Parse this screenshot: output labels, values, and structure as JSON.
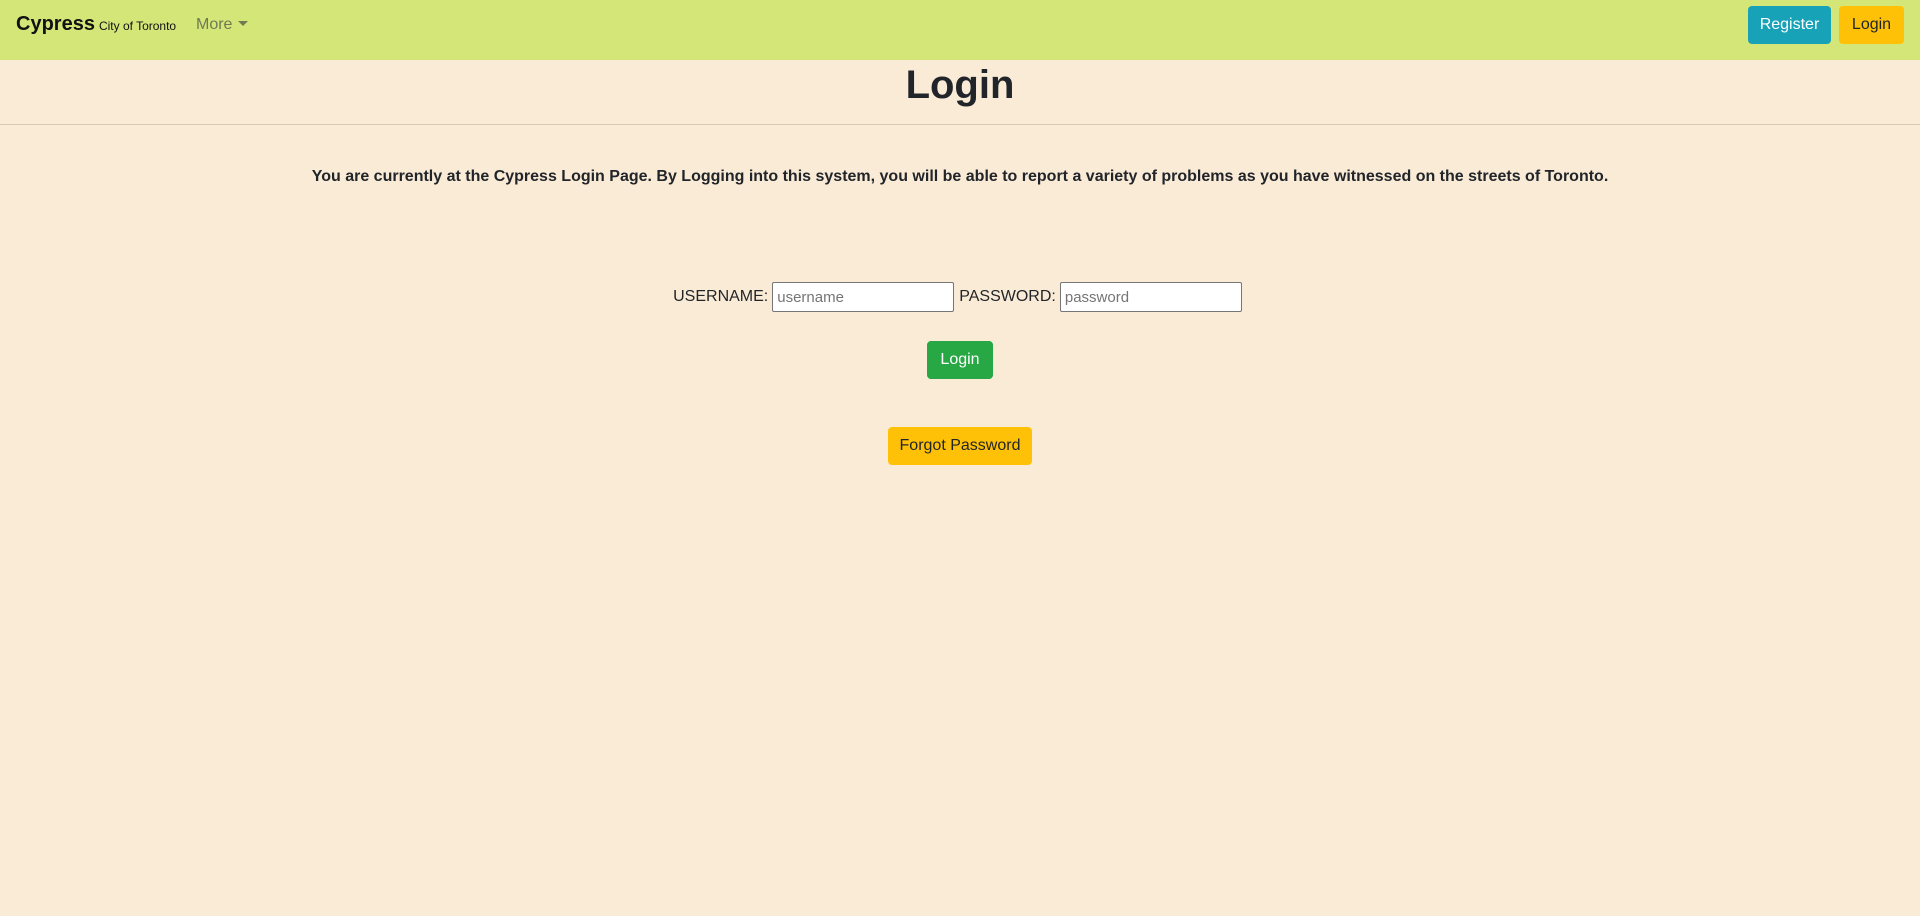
{
  "navbar": {
    "brand": "Cypress",
    "brand_sub": "City of Toronto",
    "more_label": "More",
    "register_label": "Register",
    "login_label": "Login"
  },
  "main": {
    "title": "Login",
    "intro": "You are currently at the Cypress Login Page. By Logging into this system, you will be able to report a variety of problems as you have witnessed on the streets of Toronto.",
    "form": {
      "username_label": "USERNAME:",
      "username_placeholder": "username",
      "username_value": "",
      "password_label": "PASSWORD:",
      "password_placeholder": "password",
      "password_value": "",
      "submit_label": "Login",
      "forgot_label": "Forgot Password"
    }
  },
  "colors": {
    "navbar_bg": "#d4e678",
    "page_bg": "#faebd7",
    "register_button": "#17a2b8",
    "login_button": "#ffc107",
    "submit_button": "#28a745",
    "forgot_button": "#ffc107"
  },
  "icons": {
    "more_dropdown": "chevron-down-icon"
  }
}
